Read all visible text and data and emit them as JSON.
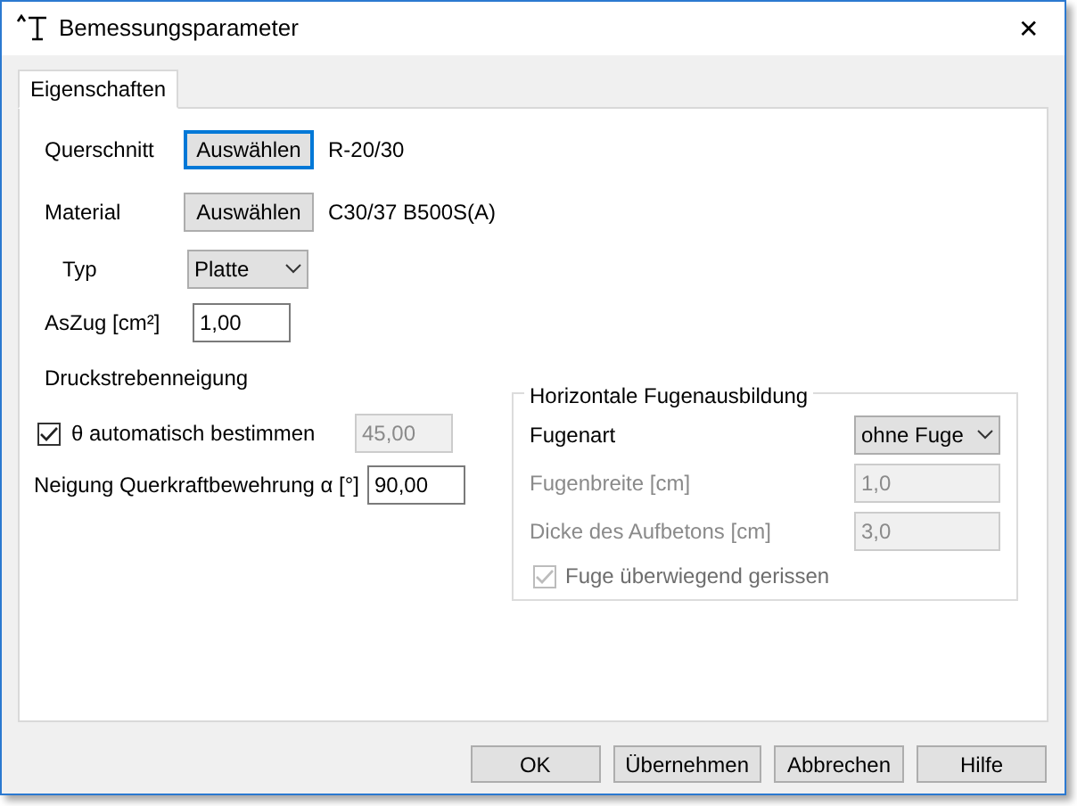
{
  "window": {
    "title": "Bemessungsparameter",
    "close": "✕"
  },
  "tabs": [
    {
      "label": "Eigenschaften",
      "selected": true
    }
  ],
  "selectors": [
    {
      "label": "Querschnitt",
      "button": "Auswählen",
      "focused": true,
      "value": "R-20/30"
    },
    {
      "label": "Material",
      "button": "Auswählen",
      "focused": false,
      "value": "C30/37 B500S(A)"
    }
  ],
  "typ": {
    "label": "Typ",
    "value": "Platte"
  },
  "aszug": {
    "label": "AsZug [cm²]",
    "value": "1,00"
  },
  "druckstrebe": {
    "title": "Druckstrebenneigung",
    "theta": {
      "label": "θ automatisch bestimmen",
      "checked": true,
      "value": "45,00",
      "disabled": true
    },
    "neigung": {
      "label": "Neigung Querkraftbewehrung α [°]",
      "value": "90,00"
    }
  },
  "fugen": {
    "title": "Horizontale Fugenausbildung",
    "fugenart": {
      "label": "Fugenart",
      "value": "ohne Fuge"
    },
    "fields": [
      {
        "label": "Fugenbreite [cm]",
        "value": "1,0",
        "disabled": true
      },
      {
        "label": "Dicke des Aufbetons [cm]",
        "value": "3,0",
        "disabled": true
      }
    ],
    "gerissen": {
      "label": "Fuge überwiegend gerissen",
      "checked": true,
      "disabled": true
    }
  },
  "buttons": [
    "OK",
    "Übernehmen",
    "Abbrechen",
    "Hilfe"
  ]
}
